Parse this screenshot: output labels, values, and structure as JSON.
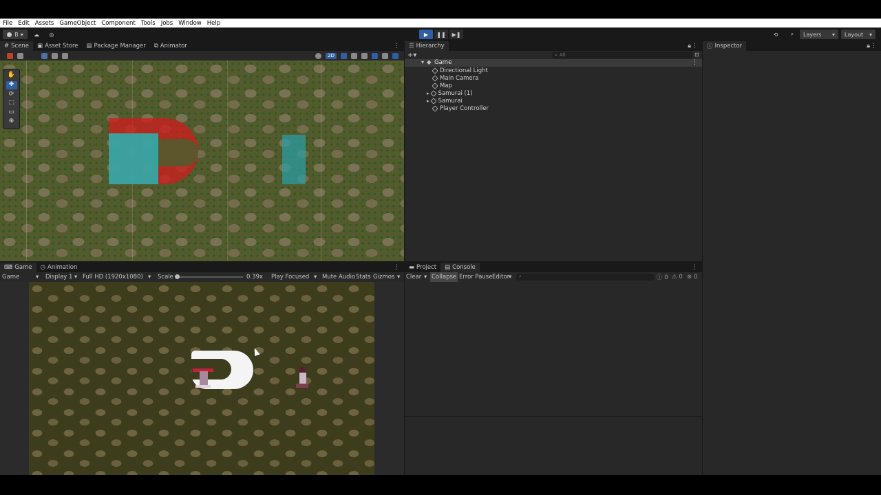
{
  "menu": [
    "File",
    "Edit",
    "Assets",
    "GameObject",
    "Component",
    "Tools",
    "Jobs",
    "Window",
    "Help"
  ],
  "toolbar": {
    "account": "B",
    "play": "▶",
    "pause": "❚❚",
    "step": "▶❚",
    "layers": "Layers",
    "layout": "Layout"
  },
  "scene": {
    "tabs": [
      "Scene",
      "Asset Store",
      "Package Manager",
      "Animator"
    ],
    "mode_2d": "2D"
  },
  "hierarchy": {
    "tab": "Hierarchy",
    "search_placeholder": "All",
    "root": "Game",
    "items": [
      "Directional Light",
      "Main Camera",
      "Map",
      "Samurai (1)",
      "Samurai",
      "Player Controller"
    ]
  },
  "inspector": {
    "tab": "Inspector"
  },
  "game": {
    "tabs": [
      "Game",
      "Animation"
    ],
    "view": "Game",
    "display": "Display 1",
    "resolution": "Full HD (1920x1080)",
    "scale_label": "Scale",
    "scale_value": "0.39x",
    "play_focused": "Play Focused",
    "mute": "Mute Audio",
    "stats": "Stats",
    "gizmos": "Gizmos"
  },
  "console": {
    "tabs": [
      "Project",
      "Console"
    ],
    "clear": "Clear",
    "collapse": "Collapse",
    "error_pause": "Error Pause",
    "editor": "Editor",
    "count_info": "0",
    "count_warn": "0",
    "count_error": "0"
  }
}
